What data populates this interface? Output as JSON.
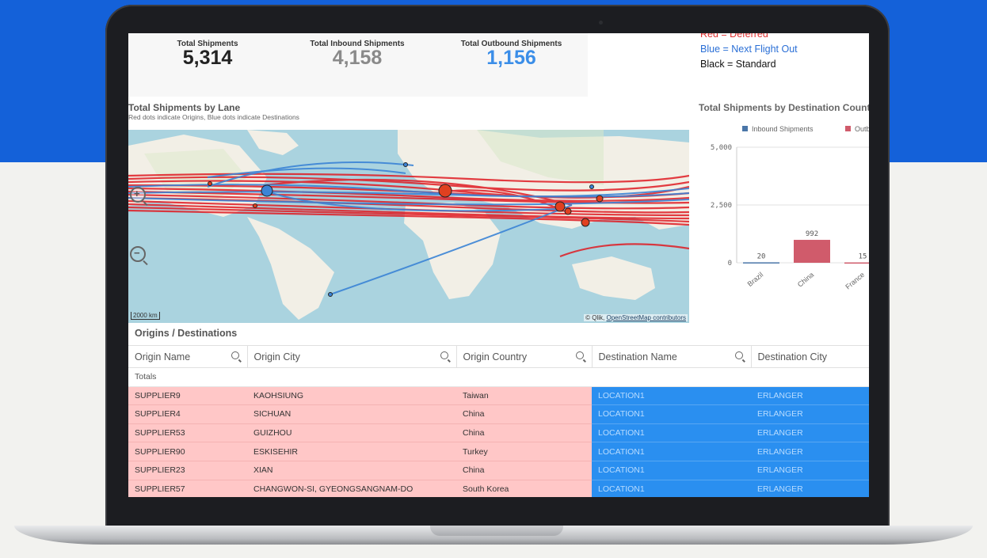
{
  "kpis": [
    {
      "label": "Total Shipments",
      "value": "5,314",
      "color": "#222222"
    },
    {
      "label": "Total Inbound Shipments",
      "value": "4,158",
      "color": "#8a8a8a"
    },
    {
      "label": "Total Outbound Shipments",
      "value": "1,156",
      "color": "#3b8ee8"
    }
  ],
  "legend": {
    "red": "Red = Deferred",
    "blue": "Blue = Next Flight Out",
    "black": "Black = Standard"
  },
  "map": {
    "title": "Total Shipments by Lane",
    "subtitle": "Red dots indicate Origins, Blue dots indicate Destinations",
    "scale": "2000 km",
    "attribution_prefix": "© Qlik, ",
    "attribution_link": "OpenStreetMap contributors",
    "zoom_in": "+",
    "zoom_out": "−"
  },
  "bar_chart": {
    "title": "Total Shipments by Destination Country",
    "chart_data": {
      "type": "bar",
      "categories": [
        "Brazil",
        "China",
        "France"
      ],
      "series": [
        {
          "name": "Inbound Shipments",
          "color": "#4a76a8",
          "values": [
            20,
            null,
            null
          ]
        },
        {
          "name": "Outbound Shipments",
          "color": "#d05b6b",
          "values": [
            null,
            992,
            15
          ]
        }
      ],
      "yticks": [
        "5,000",
        "2,500",
        "0"
      ],
      "ylim": [
        0,
        5000
      ],
      "labels": [
        "20",
        "992",
        "15"
      ]
    }
  },
  "table": {
    "title": "Origins / Destinations",
    "columns": [
      "Origin Name",
      "Origin City",
      "Origin Country",
      "Destination Name",
      "Destination City"
    ],
    "totals_label": "Totals",
    "rows": [
      [
        "SUPPLIER9",
        "KAOHSIUNG",
        "Taiwan",
        "LOCATION1",
        "ERLANGER"
      ],
      [
        "SUPPLIER4",
        "SICHUAN",
        "China",
        "LOCATION1",
        "ERLANGER"
      ],
      [
        "SUPPLIER53",
        "GUIZHOU",
        "China",
        "LOCATION1",
        "ERLANGER"
      ],
      [
        "SUPPLIER90",
        "ESKISEHIR",
        "Turkey",
        "LOCATION1",
        "ERLANGER"
      ],
      [
        "SUPPLIER23",
        "XIAN",
        "China",
        "LOCATION1",
        "ERLANGER"
      ],
      [
        "SUPPLIER57",
        "CHANGWON-SI, GYEONGSANGNAM-DO",
        "South Korea",
        "LOCATION1",
        "ERLANGER"
      ]
    ]
  }
}
